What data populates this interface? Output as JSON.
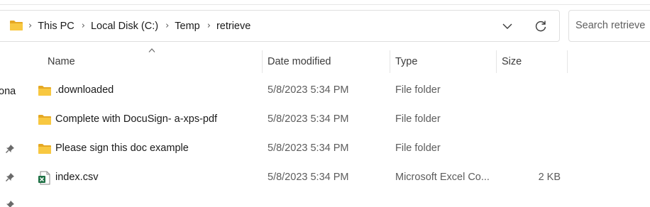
{
  "address_bar": {
    "breadcrumbs": [
      "This PC",
      "Local Disk (C:)",
      "Temp",
      "retrieve"
    ],
    "separator": "›"
  },
  "search": {
    "placeholder": "Search retrieve"
  },
  "nav_pane": {
    "partial_label": "ona"
  },
  "columns": {
    "name": "Name",
    "date": "Date modified",
    "type": "Type",
    "size": "Size"
  },
  "files": [
    {
      "name": ".downloaded",
      "date": "5/8/2023 5:34 PM",
      "type": "File folder",
      "size": "",
      "icon": "folder-icon"
    },
    {
      "name": "Complete with DocuSign- a-xps-pdf",
      "date": "5/8/2023 5:34 PM",
      "type": "File folder",
      "size": "",
      "icon": "folder-icon"
    },
    {
      "name": "Please sign this doc example",
      "date": "5/8/2023 5:34 PM",
      "type": "File folder",
      "size": "",
      "icon": "folder-icon"
    },
    {
      "name": "index.csv",
      "date": "5/8/2023 5:34 PM",
      "type": "Microsoft Excel Co...",
      "size": "2 KB",
      "icon": "excel-csv-icon"
    }
  ],
  "colors": {
    "folder": "#f8c841",
    "folder_dark": "#e5a823",
    "excel_green": "#1d7044",
    "border": "#dfdfdf"
  }
}
